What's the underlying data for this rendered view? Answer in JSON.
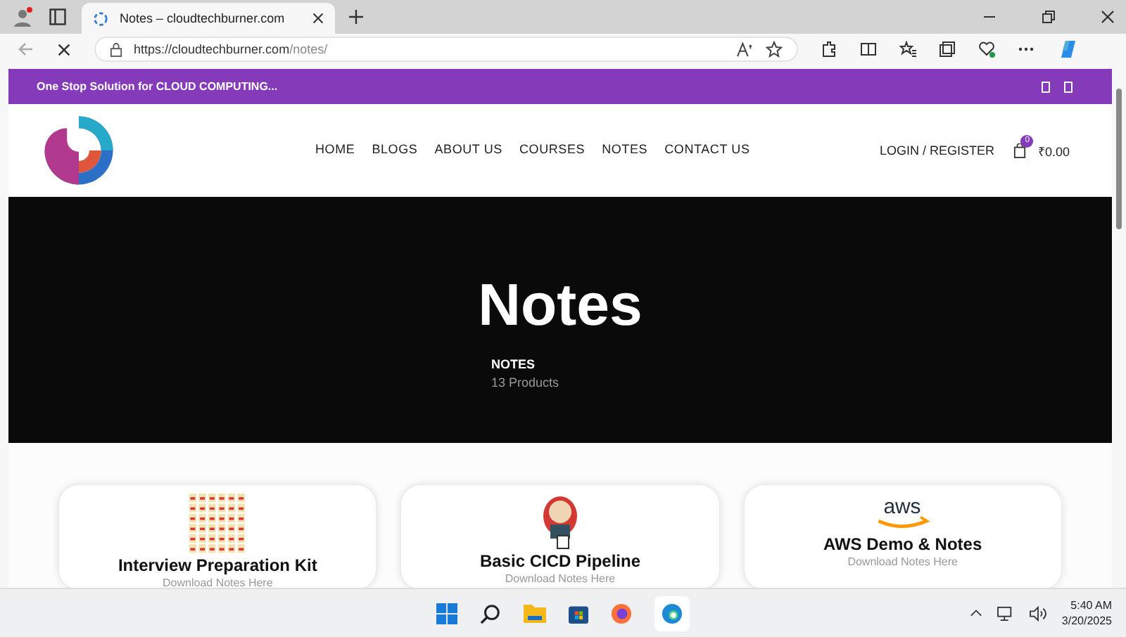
{
  "browser": {
    "tab_title": "Notes – cloudtechburner.com",
    "url_host": "https://cloudtechburner.com",
    "url_path": "/notes/"
  },
  "topbar": {
    "text": "One Stop Solution for CLOUD COMPUTING..."
  },
  "nav": [
    {
      "label": "HOME"
    },
    {
      "label": "BLOGS"
    },
    {
      "label": "ABOUT US"
    },
    {
      "label": "COURSES"
    },
    {
      "label": "NOTES"
    },
    {
      "label": "CONTACT US"
    }
  ],
  "account": {
    "login": "LOGIN / REGISTER",
    "cart_count": "0",
    "cart_total": "₹0.00"
  },
  "hero": {
    "title": "Notes",
    "category": "NOTES",
    "count": "13 Products"
  },
  "cards": [
    {
      "kind": "grid",
      "title": "Interview Preparation Kit",
      "subtitle": "Download Notes Here"
    },
    {
      "kind": "jenkins",
      "title": "Basic CICD Pipeline",
      "subtitle": "Download Notes Here"
    },
    {
      "kind": "aws",
      "title": "AWS Demo & Notes",
      "subtitle": "Download Notes Here"
    }
  ],
  "taskbar": {
    "time": "5:40 AM",
    "date": "3/20/2025"
  }
}
